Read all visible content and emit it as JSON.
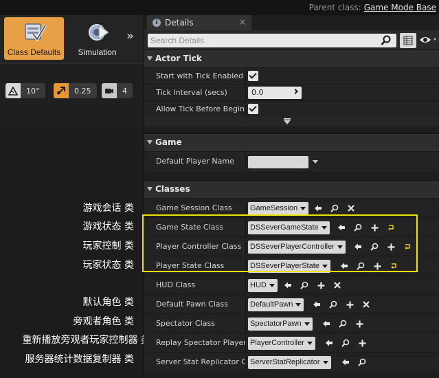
{
  "topbar": {
    "parent_label": "Parent class:",
    "parent_value": "Game Mode Base"
  },
  "toolbar": {
    "buttons": [
      {
        "label": "Class Defaults",
        "active": true,
        "icon": "class-defaults-icon"
      },
      {
        "label": "Simulation",
        "active": false,
        "icon": "simulation-icon"
      }
    ],
    "more": "»"
  },
  "snap": {
    "rotate": "10°",
    "scale": "0.25",
    "camera_speed": "4"
  },
  "details": {
    "tab_label": "Details",
    "search_placeholder": "Search Details",
    "sections": {
      "actor_tick": {
        "title": "Actor Tick",
        "start_tick_label": "Start with Tick Enabled",
        "start_tick_checked": true,
        "tick_interval_label": "Tick Interval (secs)",
        "tick_interval_value": "0.0",
        "allow_tick_label": "Allow Tick Before Begin P",
        "allow_tick_checked": true
      },
      "game": {
        "title": "Game",
        "default_player_name_label": "Default Player Name",
        "default_player_name_value": ""
      },
      "classes": {
        "title": "Classes",
        "rows": [
          {
            "label": "Game Session Class",
            "value": "GameSession",
            "actions": [
              "use",
              "browse",
              "clear"
            ]
          },
          {
            "label": "Game State Class",
            "value": "DSSeverGameState",
            "actions": [
              "use",
              "browse",
              "add",
              "reset"
            ]
          },
          {
            "label": "Player Controller Class",
            "value": "DSSeverPlayerController",
            "actions": [
              "use",
              "browse",
              "add",
              "reset"
            ]
          },
          {
            "label": "Player State Class",
            "value": "DSSeverPlayerState",
            "actions": [
              "use",
              "browse",
              "add",
              "reset"
            ]
          },
          {
            "label": "HUD Class",
            "value": "HUD",
            "actions": [
              "use",
              "browse",
              "add",
              "clear"
            ]
          },
          {
            "label": "Default Pawn Class",
            "value": "DefaultPawn",
            "actions": [
              "use",
              "browse",
              "add",
              "clear"
            ]
          },
          {
            "label": "Spectator Class",
            "value": "SpectatorPawn",
            "actions": [
              "use",
              "browse",
              "add"
            ]
          },
          {
            "label": "Replay Spectator Player C",
            "value": "PlayerController",
            "actions": [
              "use",
              "browse",
              "add"
            ]
          },
          {
            "label": "Server Stat Replicator Cla",
            "value": "ServerStatReplicator",
            "actions": [
              "use",
              "browse"
            ]
          }
        ]
      }
    }
  },
  "annotations": [
    "游戏会话 类",
    "游戏状态 类",
    "玩家控制 类",
    "玩家状态 类",
    "默认角色 类",
    "旁观者角色 类",
    "重新播放旁观者玩家控制器 类",
    "服务器统计数据复制器 类"
  ],
  "colors": {
    "accent_active": "#e8a046",
    "highlight": "#f2e20a",
    "panel": "#1e1e1e"
  }
}
